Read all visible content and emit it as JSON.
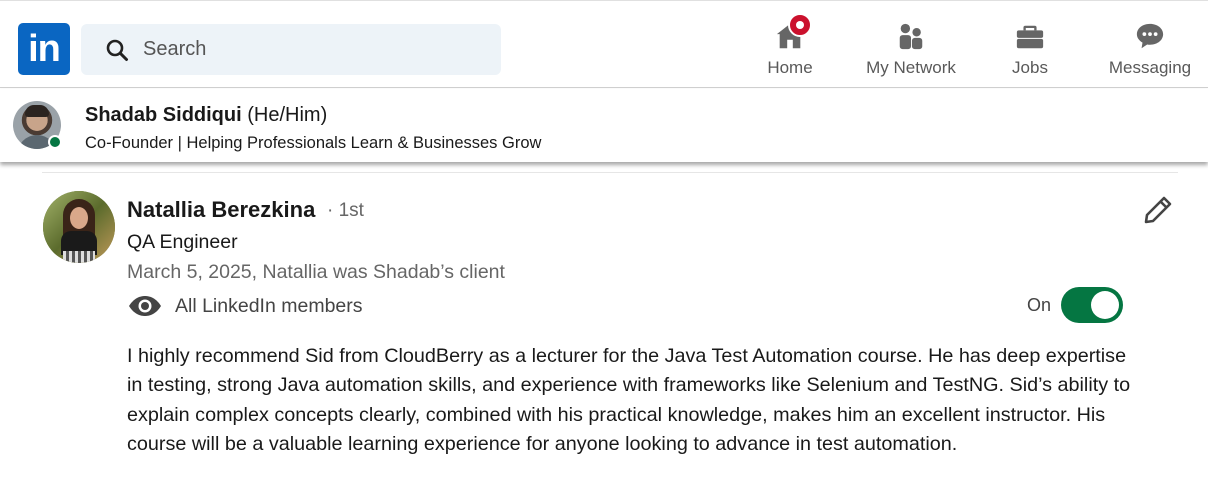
{
  "brand": {
    "logo_text": "in",
    "color": "#0a66c2"
  },
  "search": {
    "placeholder": "Search",
    "icon": "search-icon"
  },
  "nav": {
    "home": {
      "label": "Home",
      "icon": "home-icon",
      "has_notification_badge": true,
      "badge_color": "#cb112d"
    },
    "network": {
      "label": "My Network",
      "icon": "people-icon"
    },
    "jobs": {
      "label": "Jobs",
      "icon": "briefcase-icon"
    },
    "messaging": {
      "label": "Messaging",
      "icon": "chat-icon"
    }
  },
  "profile_bar": {
    "name": "Shadab Siddiqui",
    "pronouns": "(He/Him)",
    "headline": "Co-Founder | Helping Professionals Learn & Businesses Grow",
    "online": true,
    "online_color": "#057642"
  },
  "recommendation": {
    "name": "Natallia Berezkina",
    "degree": "· 1st",
    "title": "QA Engineer",
    "date_relation": "March 5, 2025, Natallia was Shadab’s client",
    "visibility": {
      "icon": "eye-icon",
      "label": "All LinkedIn members"
    },
    "toggle": {
      "label": "On",
      "state": true,
      "color": "#057642"
    },
    "edit_icon": "pencil-icon",
    "text": "I highly recommend Sid from CloudBerry as a lecturer for the Java Test Automation course. He has deep expertise in testing, strong Java automation skills, and experience with frameworks like Selenium and TestNG. Sid’s ability to explain complex concepts clearly, combined with his practical knowledge, makes him an excellent instructor. His course will be a valuable learning experience for anyone looking to advance in test automation."
  }
}
